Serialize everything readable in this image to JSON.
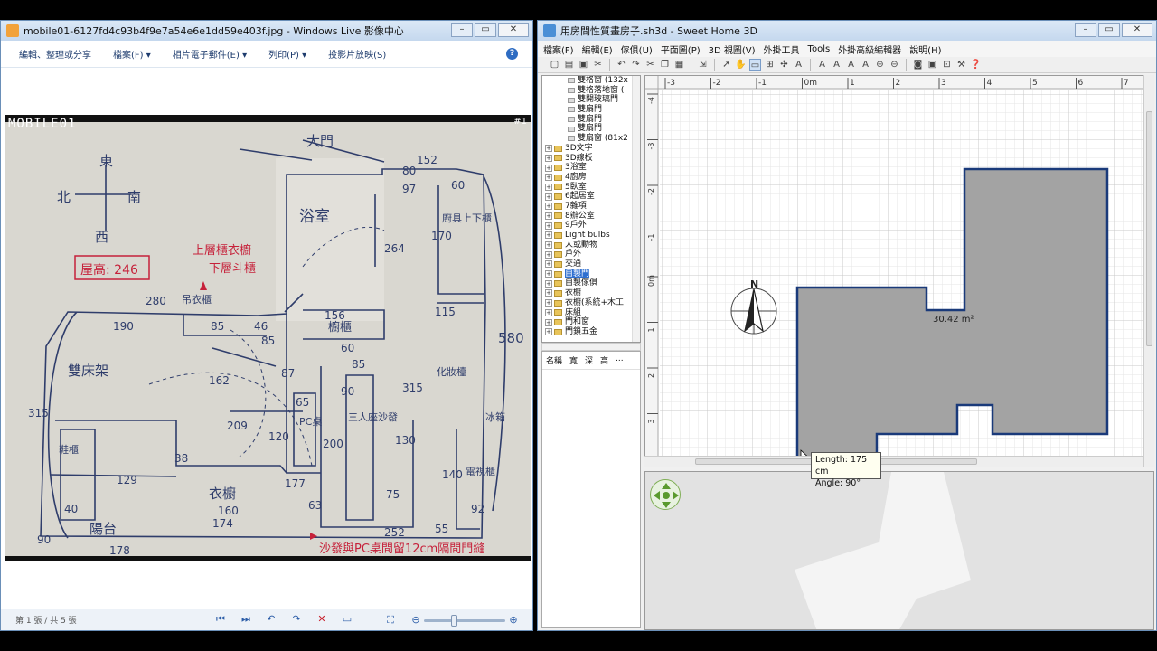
{
  "gallery": {
    "title": "mobile01-6127fd4c93b4f9e7a54e6e1dd59e403f.jpg - Windows Live 影像中心",
    "commands": [
      "編輯、整理或分享",
      "檔案(F) ▾",
      "相片電子郵件(E) ▾",
      "列印(P) ▾",
      "投影片放映(S)"
    ],
    "help": "?",
    "photo_logo": "MOBILE01",
    "photo_badge": "#1",
    "status": "第 1 張 / 共 5 張"
  },
  "sketch": {
    "notes": {
      "directions": [
        "東",
        "北",
        "南",
        "西"
      ],
      "door": "大門",
      "height": "屋高: 246",
      "upper_cabinet": "上層櫃衣櫥",
      "lower_cabinet": "下層斗櫃",
      "shoe_cabinet": "鞋櫃",
      "ceiling_cabinet": "吊衣櫃",
      "bathroom": "浴室",
      "bed": "雙床架",
      "wardrobe": "衣櫥",
      "pc": "PC桌",
      "sofa": "三人座沙發",
      "balcony": "陽台",
      "cabinet": "櫥櫃",
      "tv_cabinet": "電視櫃",
      "fridge": "冰箱",
      "kitchen_cabinet": "廚具上下櫃",
      "dresser": "化妝檯",
      "bottom_note": "沙發與PC桌間留12cm隔間門縫",
      "dims": [
        "280",
        "190",
        "85",
        "46",
        "85",
        "162",
        "87",
        "156",
        "60",
        "85",
        "315",
        "209",
        "129",
        "174",
        "178",
        "160",
        "130",
        "252",
        "55",
        "140",
        "115",
        "580",
        "315",
        "170",
        "264",
        "60",
        "97",
        "80",
        "152",
        "90",
        "63",
        "200",
        "75",
        "92",
        "38",
        "40",
        "65",
        "120",
        "177",
        "90"
      ]
    }
  },
  "sh3d": {
    "title": "用房間性質畫房子.sh3d - Sweet Home 3D",
    "menus": [
      "檔案(F)",
      "編輯(E)",
      "傢俱(U)",
      "平面圖(P)",
      "3D 視圖(V)",
      "外掛工具",
      "Tools",
      "外掛高級編輯器",
      "說明(H)"
    ],
    "catalog_top": [
      "雙格窗 (132x",
      "雙格落地窗 (",
      "雙開玻璃門",
      "雙扇門",
      "雙扇門",
      "雙扇門",
      "雙扇窗 (81x2"
    ],
    "catalog": [
      "3D文字",
      "3D線板",
      "3浴室",
      "4廚房",
      "5臥室",
      "6起居室",
      "7雜項",
      "8辦公室",
      "9戶外",
      "Light bulbs",
      "人或動物",
      "戶外",
      "交通",
      "自製門",
      "自製傢俱",
      "衣櫥",
      "衣櫥(系統+木工",
      "床組",
      "門和窗",
      "門鎖五金"
    ],
    "selected": "自製門",
    "furniture_headers": [
      "名稱",
      "寬",
      "深",
      "高",
      "..."
    ],
    "ruler_x": [
      "-3",
      "-2",
      "-1",
      "0m",
      "1",
      "2",
      "3",
      "4",
      "5",
      "6",
      "7"
    ],
    "ruler_y": [
      "-4",
      "-3",
      "-2",
      "-1",
      "0m",
      "1",
      "2",
      "3"
    ],
    "compass": "N",
    "room_area": "30.42 m²",
    "tooltip_length": "Length: 175 cm",
    "tooltip_angle": "Angle: 90°"
  },
  "colors": {
    "room_fill": "#a3a3a3",
    "wall": "#1a3a7a",
    "ink_red": "#c6213a",
    "ink_blue": "#2f3d6b"
  }
}
